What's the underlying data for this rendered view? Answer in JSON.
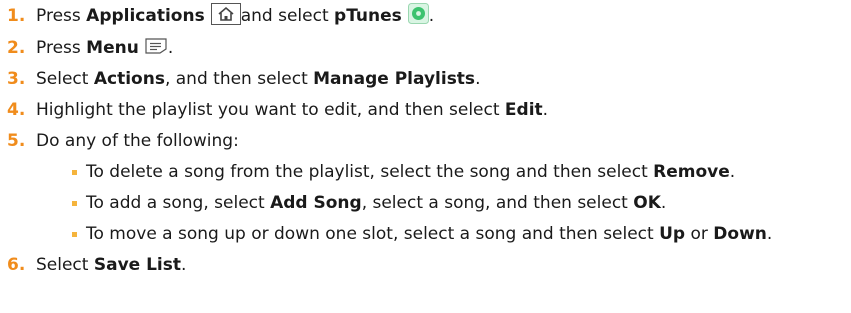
{
  "steps": [
    {
      "number": "1.",
      "t1": "Press ",
      "b1": "Applications",
      "icon1": "home-key-icon",
      "t2": " and select ",
      "b2": "pTunes",
      "icon2": "ptunes-app-icon",
      "t3": "."
    },
    {
      "number": "2.",
      "t1": "Press ",
      "b1": "Menu",
      "icon1": "menu-key-icon",
      "t2": "."
    },
    {
      "number": "3.",
      "t1": "Select ",
      "b1": "Actions",
      "t2": ", and then select ",
      "b2": "Manage Playlists",
      "t3": "."
    },
    {
      "number": "4.",
      "t1": "Highlight the playlist you want to edit, and then select ",
      "b1": "Edit",
      "t2": "."
    },
    {
      "number": "5.",
      "t1": "Do any of the following:"
    },
    {
      "number": "6.",
      "t1": "Select ",
      "b1": "Save List",
      "t2": "."
    }
  ],
  "sub_items": [
    {
      "t1": "To delete a song from the playlist, select the song and then select ",
      "b1": "Remove",
      "t2": "."
    },
    {
      "t1": "To add a song, select ",
      "b1": "Add Song",
      "t2": ", select a song, and then select ",
      "b2": "OK",
      "t3": "."
    },
    {
      "t1": "To move a song up or down one slot, select a song and then select ",
      "b1": "Up",
      "t2": " or ",
      "b2": "Down",
      "t3": "."
    }
  ],
  "colors": {
    "step_number": "#f08c1c",
    "bullet": "#f5b43c",
    "text": "#1a1a1a",
    "ptunes_icon": "#3cc36e"
  }
}
